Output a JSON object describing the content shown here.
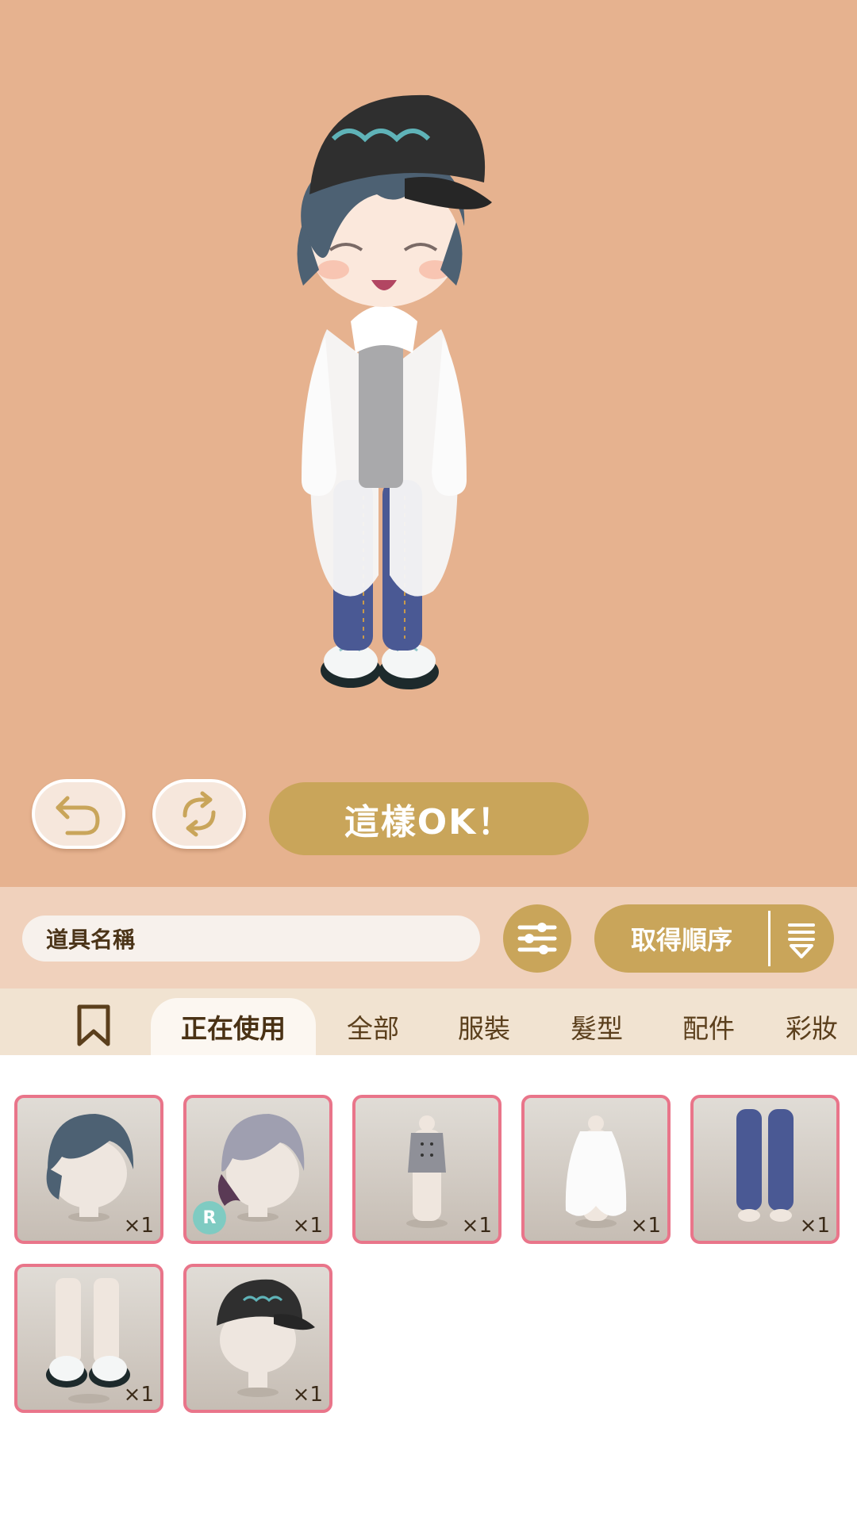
{
  "colors": {
    "stage_bg": "#e6b28f",
    "accent_gold": "#c9a55a",
    "item_border": "#e9758a"
  },
  "controls": {
    "undo_icon": "undo-icon",
    "randomize_icon": "refresh-icon",
    "confirm_label": "這樣OK！"
  },
  "search": {
    "placeholder": "道具名稱",
    "filter_icon": "sliders-icon",
    "sort_label": "取得順序",
    "sort_icon": "sort-down-icon"
  },
  "tabs": [
    {
      "label": "正在使用",
      "active": true
    },
    {
      "label": "全部",
      "active": false
    },
    {
      "label": "服裝",
      "active": false
    },
    {
      "label": "髮型",
      "active": false
    },
    {
      "label": "配件",
      "active": false
    },
    {
      "label": "彩妝",
      "active": false
    }
  ],
  "items": [
    {
      "name": "blue-hair",
      "count": "×1"
    },
    {
      "name": "gray-hair",
      "count": "×1",
      "rarity": "R"
    },
    {
      "name": "gray-top",
      "count": "×1"
    },
    {
      "name": "white-coat",
      "count": "×1"
    },
    {
      "name": "blue-jeans",
      "count": "×1"
    },
    {
      "name": "white-sneakers",
      "count": "×1"
    },
    {
      "name": "black-cap",
      "count": "×1"
    }
  ]
}
